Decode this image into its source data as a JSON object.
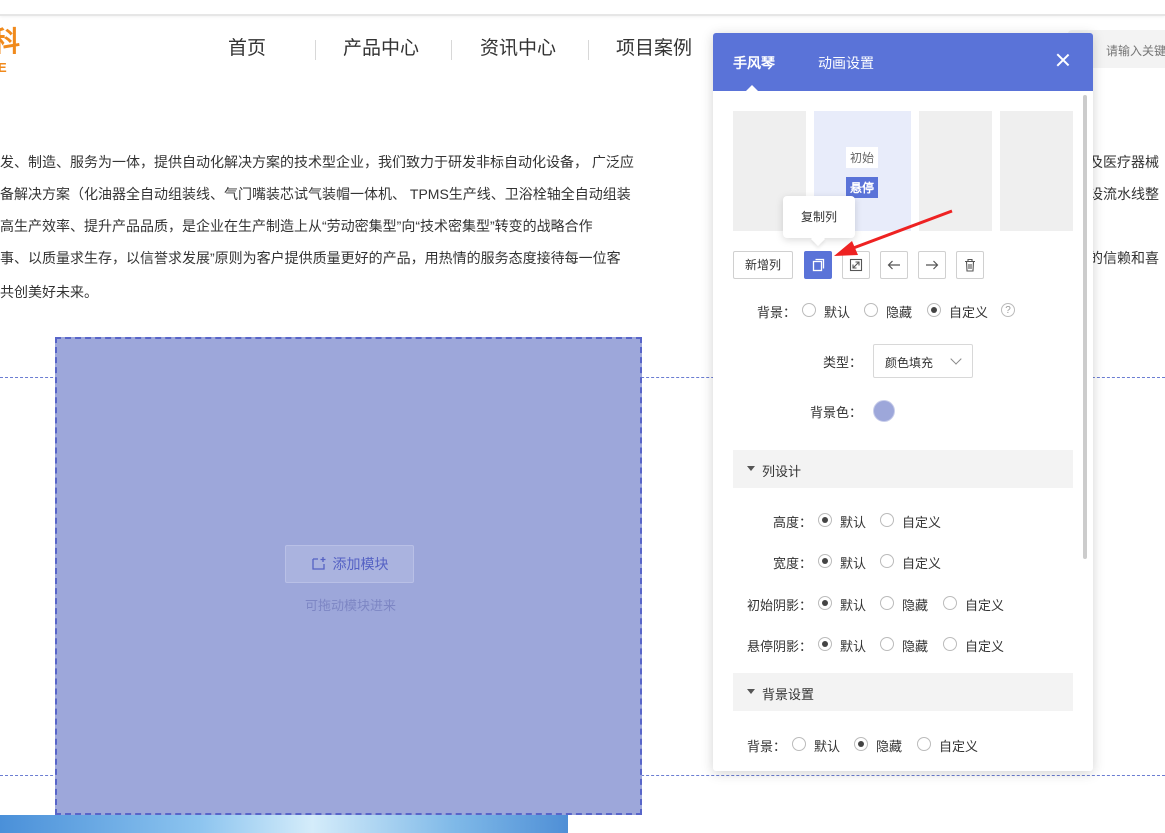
{
  "logo": {
    "line1": "科",
    "line2": "E"
  },
  "nav": {
    "items": [
      "首页",
      "产品中心",
      "资讯中心",
      "项目案例"
    ]
  },
  "search": {
    "placeholder": "请输入关键"
  },
  "intro": {
    "lines": [
      "发、制造、服务为一体，提供自动化解决方案的技术型企业，我们致力于研发非标自动化设备， 广泛应",
      "备解决方案（化油器全自动组装线、气门嘴装芯试气装帽一体机、 TPMS生产线、卫浴栓轴全自动组装",
      "高生产效率、提升产品品质，是企业在生产制造上从“劳动密集型”向“技术密集型”转变的战略合作",
      "事、以质量求生存，以信誉求发展”原则为客户提供质量更好的产品，用热情的服务态度接待每一位客",
      "共创美好未来。"
    ],
    "right_fragments": [
      "及医疗器械",
      "设流水线整",
      "",
      "的信赖和喜"
    ]
  },
  "column": {
    "add_module_label": "添加模块",
    "drag_hint": "可拖动模块进来"
  },
  "panel": {
    "tabs": [
      "手风琴",
      "动画设置"
    ],
    "thumb_labels": {
      "initial": "初始",
      "hover": "悬停"
    },
    "tooltip": "复制列",
    "add_column_label": "新增列",
    "background": {
      "label": "背景：",
      "options": [
        "默认",
        "隐藏",
        "自定义"
      ],
      "selected": "自定义",
      "help": "?"
    },
    "type": {
      "label": "类型：",
      "value": "颜色填充"
    },
    "bg_color": {
      "label": "背景色：",
      "value": "#9da7da"
    },
    "column_design": {
      "title": "列设计",
      "height": {
        "label": "高度：",
        "options": [
          "默认",
          "自定义"
        ],
        "selected": "默认"
      },
      "width": {
        "label": "宽度：",
        "options": [
          "默认",
          "自定义"
        ],
        "selected": "默认"
      },
      "initial_shadow": {
        "label": "初始阴影：",
        "options": [
          "默认",
          "隐藏",
          "自定义"
        ],
        "selected": "默认"
      },
      "hover_shadow": {
        "label": "悬停阴影：",
        "options": [
          "默认",
          "隐藏",
          "自定义"
        ],
        "selected": "默认"
      }
    },
    "bg_settings": {
      "title": "背景设置",
      "background": {
        "label": "背景：",
        "options": [
          "默认",
          "隐藏",
          "自定义"
        ],
        "selected": "隐藏"
      }
    }
  },
  "colors": {
    "accent": "#5a73d8",
    "column_fill": "#9da7da",
    "annotation_arrow": "#ee2222"
  },
  "icons": [
    "copy-icon",
    "resize-icon",
    "arrow-left-icon",
    "arrow-right-icon",
    "trash-icon",
    "close-icon",
    "add-module-icon"
  ]
}
